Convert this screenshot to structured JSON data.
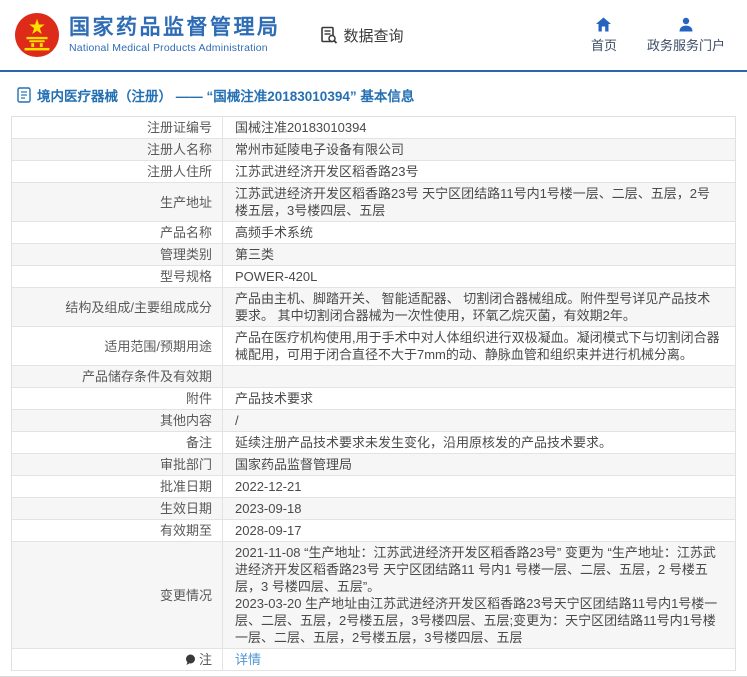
{
  "header": {
    "emblem_icon": "china-national-emblem",
    "site_name_zh": "国家药品监督管理局",
    "site_name_en": "National Medical Products Administration",
    "data_query": {
      "label": "数据查询",
      "icon": "document-search-icon"
    },
    "nav": [
      {
        "label": "首页",
        "icon": "home-icon"
      },
      {
        "label": "政务服务门户",
        "icon": "person-icon"
      }
    ]
  },
  "page": {
    "title_icon": "document-icon",
    "title": "境内医疗器械（注册） —— “国械注准20183010394” 基本信息"
  },
  "detail_table": {
    "rows": [
      {
        "label": "注册证编号",
        "value": "国械注准20183010394"
      },
      {
        "label": "注册人名称",
        "value": "常州市延陵电子设备有限公司"
      },
      {
        "label": "注册人住所",
        "value": "江苏武进经济开发区稻香路23号"
      },
      {
        "label": "生产地址",
        "value": "江苏武进经济开发区稻香路23号 天宁区团结路11号内1号楼一层、二层、五层，2号楼五层，3号楼四层、五层"
      },
      {
        "label": "产品名称",
        "value": "高频手术系统"
      },
      {
        "label": "管理类别",
        "value": "第三类"
      },
      {
        "label": "型号规格",
        "value": "POWER-420L"
      },
      {
        "label": "结构及组成/主要组成成分",
        "value": "产品由主机、脚踏开关、 智能适配器、 切割闭合器械组成。附件型号详见产品技术要求。 其中切割闭合器械为一次性使用，环氧乙烷灭菌，有效期2年。"
      },
      {
        "label": "适用范围/预期用途",
        "value": "产品在医疗机构使用,用于手术中对人体组织进行双极凝血。凝闭模式下与切割闭合器械配用，可用于闭合直径不大于7mm的动、静脉血管和组织束并进行机械分离。"
      },
      {
        "label": "产品储存条件及有效期",
        "value": ""
      },
      {
        "label": "附件",
        "value": "产品技术要求"
      },
      {
        "label": "其他内容",
        "value": "/"
      },
      {
        "label": "备注",
        "value": "延续注册产品技术要求未发生变化，沿用原核发的产品技术要求。"
      },
      {
        "label": "审批部门",
        "value": "国家药品监督管理局"
      },
      {
        "label": "批准日期",
        "value": "2022-12-21"
      },
      {
        "label": "生效日期",
        "value": "2023-09-18"
      },
      {
        "label": "有效期至",
        "value": "2028-09-17"
      },
      {
        "label": "变更情况",
        "value": "2021-11-08 “生产地址：江苏武进经济开发区稻香路23号” 变更为 “生产地址：江苏武进经济开发区稻香路23号 天宁区团结路11 号内1 号楼一层、二层、五层，2 号楼五层，3 号楼四层、五层”。\n2023-03-20 生产地址由江苏武进经济开发区稻香路23号天宁区团结路11号内1号楼一 层、二层、五层，2号楼五层，3号楼四层、五层;变更为：天宁区团结路11号内1号楼一层、二层、五层，2号楼五层，3号楼四层、五层"
      },
      {
        "label": "注",
        "label_icon": "note-icon",
        "value": "详情",
        "link": true
      }
    ]
  },
  "colors": {
    "brand_blue": "#2e6cb5",
    "divider_blue": "#2968ad",
    "page_title_blue": "#2470b3",
    "link_blue": "#4f95d6",
    "nav_icon_blue": "#2563c0",
    "emblem_red": "#de2a18",
    "emblem_gold": "#ffde00",
    "row_alt_bg": "#f6f6f6",
    "table_border": "#e3e3e3",
    "footer_bg": "#ebebeb"
  }
}
